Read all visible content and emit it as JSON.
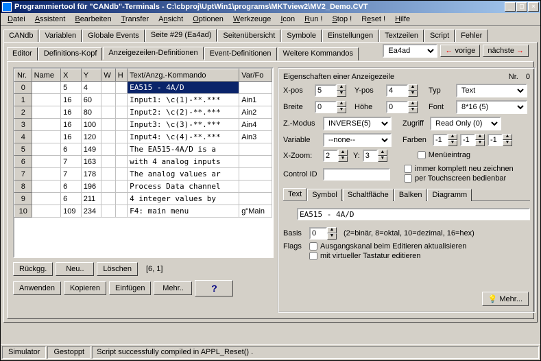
{
  "window": {
    "title": "Programmiertool für \"CANdb\"-Terminals - C:\\cbproj\\UptWin1\\programs\\MKTview2\\MV2_Demo.CVT"
  },
  "menu": {
    "items": [
      "Datei",
      "Assistent",
      "Bearbeiten",
      "Transfer",
      "Ansicht",
      "Optionen",
      "Werkzeuge",
      "Icon",
      "Run !",
      "Stop !",
      "Reset !",
      "Hilfe"
    ]
  },
  "tabs1": {
    "items": [
      "CANdb",
      "Variablen",
      "Globale Events",
      "Seite #29 (Ea4ad)",
      "Seitenübersicht",
      "Symbole",
      "Einstellungen",
      "Textzeilen",
      "Script",
      "Fehler"
    ],
    "active": 3
  },
  "tabs2": {
    "items": [
      "Editor",
      "Definitions-Kopf",
      "Anzeigezeilen-Definitionen",
      "Event-Definitionen",
      "Weitere Kommandos"
    ],
    "active": 2
  },
  "nav": {
    "value": "Ea4ad",
    "prev": "vorige",
    "next": "nächste"
  },
  "grid": {
    "headers": [
      "Nr.",
      "Name",
      "X",
      "Y",
      "W",
      "H",
      "Text/Anzg.-Kommando",
      "Var/Fo"
    ],
    "rows": [
      {
        "nr": "0",
        "name": "",
        "x": "5",
        "y": "4",
        "w": "",
        "h": "",
        "txt": "EA515 - 4A/D",
        "var": "",
        "sel": true
      },
      {
        "nr": "1",
        "name": "",
        "x": "16",
        "y": "60",
        "w": "",
        "h": "",
        "txt": "Input1: \\c(1)-**.***",
        "var": "Ain1"
      },
      {
        "nr": "2",
        "name": "",
        "x": "16",
        "y": "80",
        "w": "",
        "h": "",
        "txt": "Input2: \\c(2)-**.***",
        "var": "Ain2"
      },
      {
        "nr": "3",
        "name": "",
        "x": "16",
        "y": "100",
        "w": "",
        "h": "",
        "txt": "Input3: \\c(3)-**.***",
        "var": "Ain4"
      },
      {
        "nr": "4",
        "name": "",
        "x": "16",
        "y": "120",
        "w": "",
        "h": "",
        "txt": "Input4: \\c(4)-**.***",
        "var": "Ain3"
      },
      {
        "nr": "5",
        "name": "",
        "x": "6",
        "y": "149",
        "w": "",
        "h": "",
        "txt": "The EA515-4A/D is a",
        "var": ""
      },
      {
        "nr": "6",
        "name": "",
        "x": "7",
        "y": "163",
        "w": "",
        "h": "",
        "txt": "with 4 analog inputs",
        "var": ""
      },
      {
        "nr": "7",
        "name": "",
        "x": "7",
        "y": "178",
        "w": "",
        "h": "",
        "txt": "The analog values ar",
        "var": ""
      },
      {
        "nr": "8",
        "name": "",
        "x": "6",
        "y": "196",
        "w": "",
        "h": "",
        "txt": "Process Data channel",
        "var": ""
      },
      {
        "nr": "9",
        "name": "",
        "x": "6",
        "y": "211",
        "w": "",
        "h": "",
        "txt": "4 integer values by",
        "var": ""
      },
      {
        "nr": "10",
        "name": "",
        "x": "109",
        "y": "234",
        "w": "",
        "h": "",
        "txt": "F4: main menu",
        "var": "g\"Main"
      }
    ]
  },
  "btns": {
    "undo": "Rückgg.",
    "new": "Neu..",
    "del": "Löschen",
    "apply": "Anwenden",
    "copy": "Kopieren",
    "paste": "Einfügen",
    "more": "Mehr..",
    "coord": "[6, 1]"
  },
  "props": {
    "title": "Eigenschaften einer Anzeigezeile",
    "nrlbl": "Nr.",
    "nr": "0",
    "xpos_l": "X-pos",
    "xpos": "5",
    "ypos_l": "Y-pos",
    "ypos": "4",
    "typ_l": "Typ",
    "typ": "Text",
    "breite_l": "Breite",
    "breite": "0",
    "hoehe_l": "Höhe",
    "hoehe": "0",
    "font_l": "Font",
    "font": "8*16    (5)",
    "zmod_l": "Z.-Modus",
    "zmod": "INVERSE(5)",
    "zugr_l": "Zugriff",
    "zugr": "Read Only (0)",
    "var_l": "Variable",
    "var": "--none--",
    "farb_l": "Farben",
    "farb1": "-1",
    "farb2": "-1",
    "farb3": "-1",
    "xzoom_l": "X-Zoom:",
    "xzoom": "2",
    "yzoom_l": "Y:",
    "yzoom": "3",
    "ctrl_l": "Control ID",
    "ctrl": "",
    "chk1": "Menüeintrag",
    "chk2": "immer komplett neu zeichnen",
    "chk3": "per Touchscreen bedienbar",
    "subtabs": [
      "Text",
      "Symbol",
      "Schaltfläche",
      "Balken",
      "Diagramm"
    ],
    "subactive": 0,
    "textval": "EA515 - 4A/D",
    "basis_l": "Basis",
    "basis": "0",
    "basis_hint": "(2=binär, 8=oktal, 10=dezimal, 16=hex)",
    "flags_l": "Flags",
    "flag1": "Ausgangskanal beim Editieren aktualisieren",
    "flag2": "mit virtueller Tastatur editieren",
    "morebtn": "Mehr..."
  },
  "status": {
    "b1": "Simulator",
    "b2": "Gestoppt",
    "txt": "Script successfully compiled in APPL_Reset() ."
  }
}
